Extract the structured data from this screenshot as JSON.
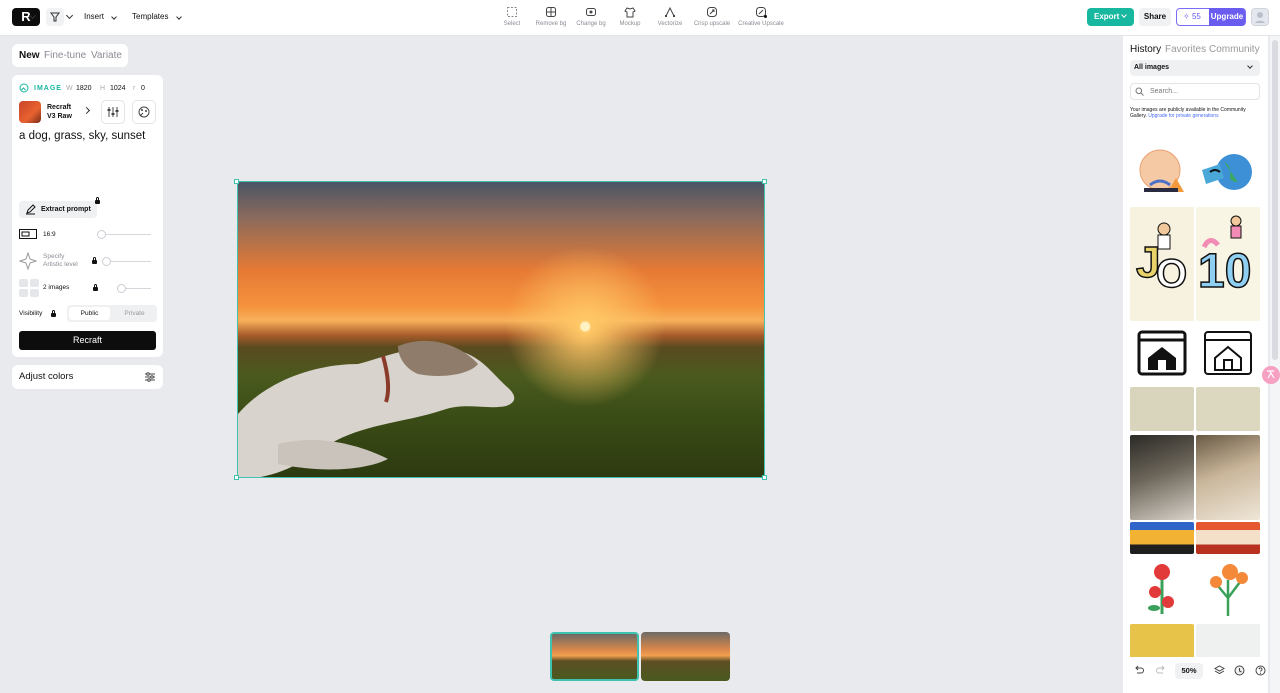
{
  "topbar": {
    "insert_label": "Insert",
    "templates_label": "Templates",
    "tools": [
      {
        "label": "Select",
        "icon": "select-icon"
      },
      {
        "label": "Remove bg",
        "icon": "remove-bg-icon"
      },
      {
        "label": "Change bg",
        "icon": "change-bg-icon"
      },
      {
        "label": "Mockup",
        "icon": "mockup-icon"
      },
      {
        "label": "Vectorize",
        "icon": "vectorize-icon"
      },
      {
        "label": "Crisp upscale",
        "icon": "crisp-upscale-icon"
      },
      {
        "label": "Creative Upscale",
        "icon": "creative-upscale-icon"
      }
    ],
    "export_label": "Export",
    "share_label": "Share",
    "credits": "55",
    "upgrade_label": "Upgrade"
  },
  "mode_tabs": [
    "New",
    "Fine-tune",
    "Variate"
  ],
  "panel": {
    "image_label": "IMAGE",
    "w_label": "W",
    "width": "1820",
    "h_label": "H",
    "height": "1024",
    "r_label": "r",
    "rotation": "0",
    "model_name_1": "Recraft",
    "model_name_2": "V3 Raw",
    "prompt": "a dog, grass, sky, sunset",
    "extract_label": "Extract prompt",
    "aspect_label": "16:9",
    "artistic_label_1": "Specify",
    "artistic_label_2": "Artistic level",
    "images_label": "2 images",
    "visibility_label": "Visibility",
    "public_label": "Public",
    "private_label": "Private",
    "recraft_label": "Recraft",
    "adjust_label": "Adjust colors"
  },
  "right": {
    "tabs": [
      "History",
      "Favorites",
      "Community"
    ],
    "filter": "All images",
    "search_placeholder": "Search...",
    "note_1": "Your images are publicly available in the Community Gallery.",
    "note_link": "Upgrade for private generations"
  },
  "bottom": {
    "zoom": "50%"
  },
  "colors": {
    "accent": "#18b7a0",
    "upgrade": "#6b5cf0",
    "selection": "#3fc3b0"
  }
}
